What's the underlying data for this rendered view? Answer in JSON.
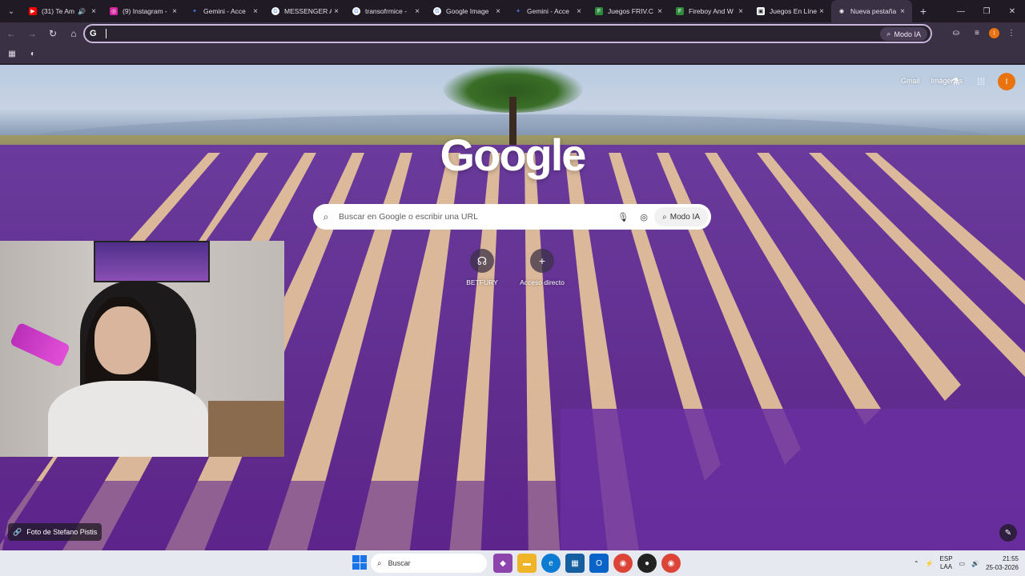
{
  "tabs": [
    {
      "title": "(31) Te Am",
      "favicon": "youtube-icon",
      "color": "#ff0000",
      "audio": true
    },
    {
      "title": "(9) Instagram -",
      "favicon": "instagram-icon",
      "color": "#d6249f"
    },
    {
      "title": "Gemini - Acce",
      "favicon": "gemini-icon",
      "color": "#4a7cf0"
    },
    {
      "title": "MESSENGER A",
      "favicon": "google-icon",
      "color": "#ffffff"
    },
    {
      "title": "transofrmice -",
      "favicon": "google-icon",
      "color": "#ffffff"
    },
    {
      "title": "Google Image",
      "favicon": "google-icon",
      "color": "#ffffff"
    },
    {
      "title": "Gemini - Acce",
      "favicon": "gemini-icon",
      "color": "#4a7cf0"
    },
    {
      "title": "Juegos FRIV.C",
      "favicon": "friv-icon",
      "color": "#2e8b3b"
    },
    {
      "title": "Fireboy And W",
      "favicon": "friv-icon",
      "color": "#2e8b3b"
    },
    {
      "title": "Juegos En Líne",
      "favicon": "poki-icon",
      "color": "#ffffff"
    },
    {
      "title": "Nueva pestaña",
      "favicon": "chrome-icon",
      "color": "#ffffff",
      "active": true
    }
  ],
  "toolbar": {
    "omnibox_value": "",
    "ai_mode_label": "Modo IA",
    "profile_initial": "I"
  },
  "ntp": {
    "gmail": "Gmail",
    "images": "Imágenes",
    "logo": "Google",
    "search_placeholder": "Buscar en Google o escribir una URL",
    "ai_mode_label": "Modo IA",
    "profile_initial": "I",
    "shortcuts": [
      {
        "label": "BETFURY",
        "icon": "betfury-icon"
      },
      {
        "label": "Acceso directo",
        "icon": "plus-icon"
      }
    ],
    "photo_credit": "Foto de Stefano Pistis"
  },
  "taskbar": {
    "search_label": "Buscar",
    "lang_top": "ESP",
    "lang_bottom": "LAA",
    "time": "21:55",
    "date": "25-03-2026",
    "accent": "#1a73e8"
  }
}
